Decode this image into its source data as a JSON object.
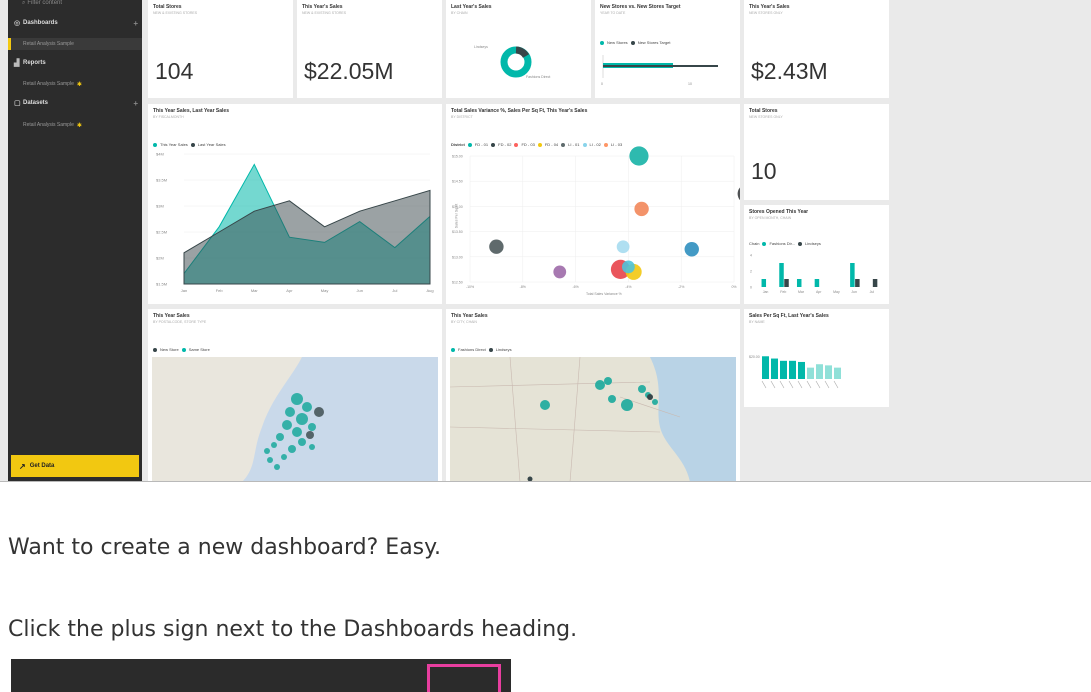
{
  "nav": {
    "filter_placeholder": "Filter content",
    "sections": [
      {
        "label": "Dashboards",
        "icon": "dashboard-icon",
        "item": "Retail Analysis Sample"
      },
      {
        "label": "Reports",
        "icon": "reports-icon",
        "item": "Retail Analysis Sample"
      },
      {
        "label": "Datasets",
        "icon": "datasets-icon",
        "item": "Retail Analysis Sample"
      }
    ],
    "get_data": "Get Data"
  },
  "tiles": {
    "total_stores": {
      "title": "Total Stores",
      "subtitle": "NEW & EXISTING STORES",
      "value": "104"
    },
    "this_year_sales": {
      "title": "This Year's Sales",
      "subtitle": "NEW & EXISTING STORES",
      "value": "$22.05M"
    },
    "last_year_sales": {
      "title": "Last Year's Sales",
      "subtitle": "BY CHAIN",
      "labels": [
        "Lindseys",
        "Fashions Direct"
      ]
    },
    "new_vs_target": {
      "title": "New Stores vs. New Stores Target",
      "subtitle": "YEAR TO DATE",
      "legend": [
        "New Stores",
        "New Stores Target"
      ],
      "ticks": [
        "0",
        "10"
      ]
    },
    "this_year_sales_new": {
      "title": "This Year's Sales",
      "subtitle": "NEW STORES ONLY",
      "value": "$2.43M"
    },
    "line_chart": {
      "title": "This Year Sales, Last Year Sales",
      "subtitle": "BY FISCALMONTH",
      "legend": [
        "This Year Sales",
        "Last Year Sales"
      ]
    },
    "scatter": {
      "title": "Total Sales Variance %, Sales Per Sq Ft, This Year's Sales",
      "subtitle": "BY DISTRICT",
      "legend_title": "District",
      "legend": [
        "FD - 01",
        "FD - 02",
        "FD - 03",
        "FD - 04",
        "LI - 01",
        "LI - 02",
        "LI - 03"
      ],
      "xlabel": "Total Sales Variance %",
      "ylabel": "Sales Per Sq Ft"
    },
    "total_stores_new": {
      "title": "Total Stores",
      "subtitle": "NEW STORES ONLY",
      "value": "10"
    },
    "stores_opened": {
      "title": "Stores Opened This Year",
      "subtitle": "BY OPEN MONTH, CHAIN",
      "legend_title": "Chain",
      "legend": [
        "Fashions Dir...",
        "Lindseys"
      ]
    },
    "map1": {
      "title": "This Year Sales",
      "subtitle": "BY POSTALCODE, STORE TYPE",
      "legend": [
        "New Store",
        "Same Store"
      ]
    },
    "map2": {
      "title": "This Year Sales",
      "subtitle": "BY CITY, CHAIN",
      "legend": [
        "Fashions Direct",
        "Lindseys"
      ]
    },
    "sales_sqft": {
      "title": "Sales Per Sq Ft, Last Year's Sales",
      "subtitle": "BY NAME",
      "ytick": "$20.00"
    }
  },
  "chart_data": [
    {
      "type": "area",
      "title": "This Year Sales, Last Year Sales",
      "categories": [
        "Jan",
        "Feb",
        "Mar",
        "Apr",
        "May",
        "Jun",
        "Jul",
        "Aug"
      ],
      "yticks": [
        "$4M",
        "$3.5M",
        "$3M",
        "$2.5M",
        "$2M",
        "$1.5M"
      ],
      "ylim": [
        1.5,
        4
      ],
      "series": [
        {
          "name": "This Year Sales",
          "values": [
            1.7,
            2.6,
            3.8,
            2.4,
            2.3,
            2.7,
            2.2,
            2.8
          ]
        },
        {
          "name": "Last Year Sales",
          "values": [
            2.1,
            2.5,
            2.9,
            3.1,
            2.6,
            2.9,
            3.1,
            3.3
          ]
        }
      ]
    },
    {
      "type": "scatter",
      "title": "Total Sales Variance %, Sales Per Sq Ft, This Year's Sales",
      "xticks": [
        "-10%",
        "-8%",
        "-6%",
        "-4%",
        "-2%",
        "0%"
      ],
      "yticks": [
        "$15.00",
        "$14.50",
        "$14.00",
        "$13.50",
        "$13.00",
        "$12.50"
      ],
      "xlim": [
        -10,
        0
      ],
      "ylim": [
        12.5,
        15
      ],
      "points": [
        {
          "x": -3.6,
          "y": 15.0,
          "r": 6,
          "color": "#17b3a6"
        },
        {
          "x": 0.5,
          "y": 14.25,
          "r": 6,
          "color": "#3b3e40"
        },
        {
          "x": -3.5,
          "y": 13.95,
          "r": 4.5,
          "color": "#f2875a"
        },
        {
          "x": -9.0,
          "y": 13.2,
          "r": 4.5,
          "color": "#4e5a5c"
        },
        {
          "x": -4.2,
          "y": 13.2,
          "r": 4,
          "color": "#a6dcef"
        },
        {
          "x": -1.6,
          "y": 13.15,
          "r": 4.5,
          "color": "#2f8fbf"
        },
        {
          "x": -6.6,
          "y": 12.7,
          "r": 4,
          "color": "#9d6aa8"
        },
        {
          "x": -4.3,
          "y": 12.75,
          "r": 6,
          "color": "#e8434a"
        },
        {
          "x": -3.8,
          "y": 12.7,
          "r": 5,
          "color": "#f2c811"
        },
        {
          "x": -4.0,
          "y": 12.8,
          "r": 4,
          "color": "#4fc3d9"
        }
      ]
    },
    {
      "type": "bar",
      "title": "Stores Opened This Year",
      "categories": [
        "Jan",
        "Feb",
        "Mar",
        "Apr",
        "May",
        "Jun",
        "Jul"
      ],
      "yticks": [
        "4",
        "2",
        "0"
      ],
      "ylim": [
        0,
        4
      ],
      "series": [
        {
          "name": "Fashions Dir...",
          "values": [
            1,
            3,
            1,
            1,
            0,
            3,
            0
          ]
        },
        {
          "name": "Lindseys",
          "values": [
            0,
            1,
            0,
            0,
            0,
            1,
            1
          ]
        }
      ]
    },
    {
      "type": "bar",
      "title": "Sales Per Sq Ft, Last Year's Sales",
      "values": [
        20,
        18,
        16,
        16,
        15,
        10,
        13,
        12,
        10
      ],
      "ylim": [
        0,
        22
      ]
    }
  ],
  "article": {
    "p1": "Want to create a new dashboard? Easy.",
    "p2": "Click the plus sign next to the Dashboards heading."
  },
  "colors": {
    "teal": "#01b8aa",
    "dark": "#374649",
    "accent": "#f2c811",
    "highlight": "#e83e9f"
  }
}
